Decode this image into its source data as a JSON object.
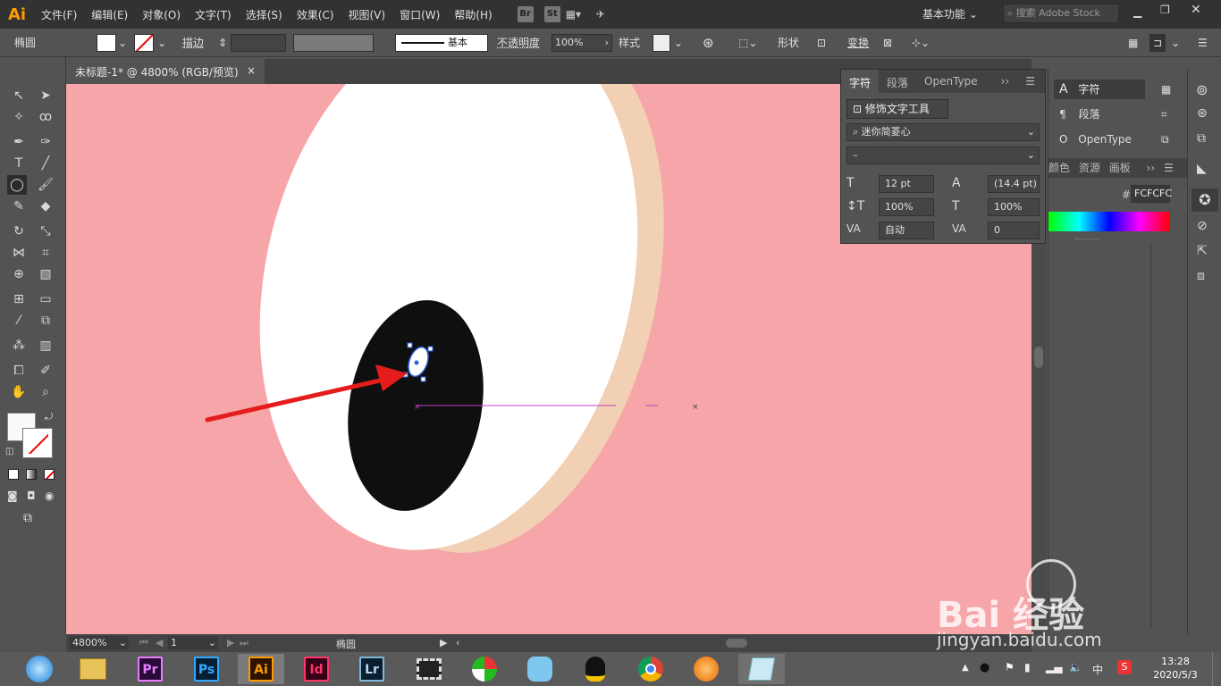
{
  "app": {
    "logo": "Ai"
  },
  "menu": [
    "文件(F)",
    "编辑(E)",
    "对象(O)",
    "文字(T)",
    "选择(S)",
    "效果(C)",
    "视图(V)",
    "窗口(W)",
    "帮助(H)"
  ],
  "menubar_icons": {
    "bridge": "Br",
    "stock": "St"
  },
  "workspace": "基本功能",
  "search_placeholder": "搜索 Adobe Stock",
  "control": {
    "object_name": "椭圆",
    "stroke_label": "描边",
    "stroke_style": "基本",
    "opacity_label": "不透明度",
    "opacity_value": "100%",
    "style_label": "样式",
    "shape_label": "形状",
    "transform_label": "变换"
  },
  "document_tab": {
    "title": "未标题-1* @ 4800% (RGB/预览)",
    "close": "×"
  },
  "character_panel": {
    "tabs": [
      "字符",
      "段落",
      "OpenType"
    ],
    "touch_type_button": "修饰文字工具",
    "font_family": "迷你简菱心",
    "font_style": "–",
    "font_size": "12 pt",
    "leading": "(14.4 pt)",
    "vertical_scale": "100%",
    "horizontal_scale": "100%",
    "kerning": "自动",
    "tracking": "0"
  },
  "side_panel": {
    "items": [
      "字符",
      "段落",
      "OpenType"
    ],
    "tabs": [
      "颜色",
      "资源",
      "画板"
    ],
    "hex_value": "FCFCFC"
  },
  "statusbar": {
    "zoom": "4800%",
    "page": "1",
    "tool": "椭圆"
  },
  "taskbar": {
    "apps": [
      "Pr",
      "Ps",
      "Ai",
      "Id",
      "Lr"
    ],
    "ime": "中",
    "time": "13:28",
    "date": "2020/5/3"
  },
  "watermark": {
    "brand": "Bai 经验",
    "url": "jingyan.baidu.com"
  },
  "colors": {
    "canvas": "#f6a5a8",
    "eye_white": "#ffffff",
    "eye_shadow": "#f2d0b4",
    "pupil": "#0f0f0f",
    "arrow": "#e41c1c",
    "guide": "#c040c0",
    "selection": "#2c5fd8"
  }
}
